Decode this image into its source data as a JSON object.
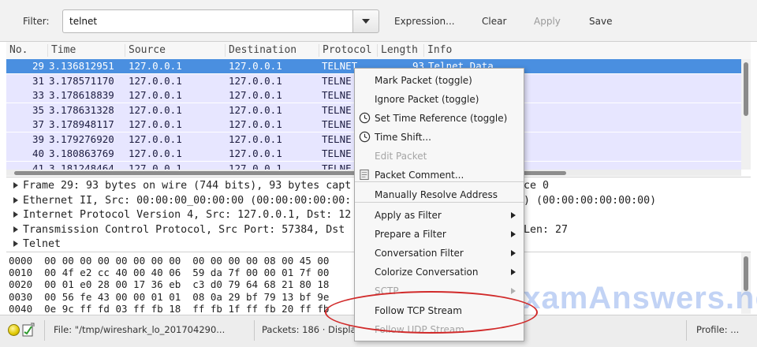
{
  "toolbar": {
    "filter_label": "Filter:",
    "filter_value": "telnet",
    "expression_label": "Expression...",
    "clear_label": "Clear",
    "apply_label": "Apply",
    "save_label": "Save"
  },
  "packet_list": {
    "columns": [
      "No.",
      "Time",
      "Source",
      "Destination",
      "Protocol",
      "Length",
      "Info"
    ],
    "rows": [
      {
        "no": "29",
        "time": "3.136812951",
        "src": "127.0.0.1",
        "dst": "127.0.0.1",
        "proto": "TELNET",
        "len": "93",
        "info": "Telnet Data ..."
      },
      {
        "no": "31",
        "time": "3.178571170",
        "src": "127.0.0.1",
        "dst": "127.0.0.1",
        "proto": "TELNE",
        "len": "",
        "info": ""
      },
      {
        "no": "33",
        "time": "3.178618839",
        "src": "127.0.0.1",
        "dst": "127.0.0.1",
        "proto": "TELNE",
        "len": "",
        "info": ""
      },
      {
        "no": "35",
        "time": "3.178631328",
        "src": "127.0.0.1",
        "dst": "127.0.0.1",
        "proto": "TELNE",
        "len": "",
        "info": ""
      },
      {
        "no": "37",
        "time": "3.178948117",
        "src": "127.0.0.1",
        "dst": "127.0.0.1",
        "proto": "TELNE",
        "len": "",
        "info": ""
      },
      {
        "no": "39",
        "time": "3.179276920",
        "src": "127.0.0.1",
        "dst": "127.0.0.1",
        "proto": "TELNE",
        "len": "",
        "info": ""
      },
      {
        "no": "40",
        "time": "3.180863769",
        "src": "127.0.0.1",
        "dst": "127.0.0.1",
        "proto": "TELNE",
        "len": "",
        "info": ""
      },
      {
        "no": "41",
        "time": "3.181248464",
        "src": "127.0.0.1",
        "dst": "127.0.0.1",
        "proto": "TELNE",
        "len": "",
        "info": ""
      }
    ]
  },
  "details": [
    "Frame 29: 93 bytes on wire (744 bits), 93 bytes capt",
    "Ethernet II, Src: 00:00:00_00:00:00 (00:00:00:00:00:",
    "Internet Protocol Version 4, Src: 127.0.0.1, Dst: 12",
    "Transmission Control Protocol, Src Port: 57384, Dst",
    "Telnet"
  ],
  "details_right": [
    "ce 0",
    ") (00:00:00:00:00:00)",
    "",
    "Len: 27",
    ""
  ],
  "bytes": [
    "0000  00 00 00 00 00 00 00 00  00 00 00 00 08 00 45 00",
    "0010  00 4f e2 cc 40 00 40 06  59 da 7f 00 00 01 7f 00",
    "0020  00 01 e0 28 00 17 36 eb  c3 d0 79 64 68 21 80 18",
    "0030  00 56 fe 43 00 00 01 01  08 0a 29 bf 79 13 bf 9e",
    "0040  0e 9c ff fd 03 ff fb 18  ff fb 1f ff fb 20 ff fb"
  ],
  "context_menu": {
    "items": [
      {
        "label": "Mark Packet (toggle)",
        "enabled": true
      },
      {
        "label": "Ignore Packet (toggle)",
        "enabled": true
      },
      {
        "label": "Set Time Reference (toggle)",
        "enabled": true,
        "icon": "clock-icon"
      },
      {
        "label": "Time Shift...",
        "enabled": true,
        "icon": "clock-icon"
      },
      {
        "label": "Edit Packet",
        "enabled": false
      },
      {
        "label": "Packet Comment...",
        "enabled": true,
        "icon": "comment-icon"
      },
      {
        "label": "Manually Resolve Address",
        "enabled": true
      },
      {
        "label": "Apply as Filter",
        "enabled": true,
        "submenu": true
      },
      {
        "label": "Prepare a Filter",
        "enabled": true,
        "submenu": true
      },
      {
        "label": "Conversation Filter",
        "enabled": true,
        "submenu": true
      },
      {
        "label": "Colorize Conversation",
        "enabled": true,
        "submenu": true
      },
      {
        "label": "SCTP",
        "enabled": false,
        "submenu": true
      },
      {
        "label": "Follow TCP Stream",
        "enabled": true
      },
      {
        "label": "Follow UDP Stream",
        "enabled": false
      }
    ]
  },
  "statusbar": {
    "file": "File: \"/tmp/wireshark_lo_201704290...",
    "packets": "Packets: 186 · Displaye",
    "profile": "Profile: ..."
  },
  "watermark": "ITExamAnswers.net",
  "colors": {
    "selected_row": "#4a8fe0",
    "row_bg": "#e7e6ff",
    "highlight_ring": "#d12a2a",
    "watermark": "#6e96e6"
  }
}
